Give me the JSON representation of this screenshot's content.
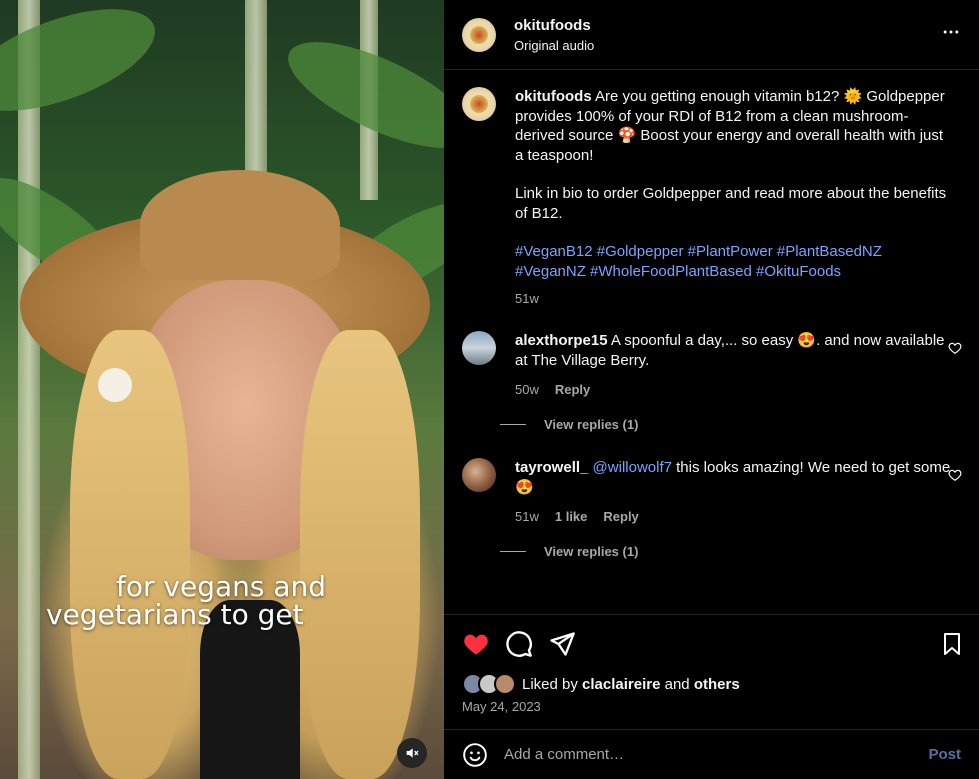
{
  "video": {
    "caption_line1": "for vegans and",
    "caption_line2": "vegetarians to get",
    "mute_icon": "speaker-muted-icon"
  },
  "header": {
    "username": "okitufoods",
    "audio": "Original audio",
    "more_icon": "more-horizontal-icon"
  },
  "post": {
    "username": "okitufoods",
    "text1": "Are you getting enough vitamin b12? 🌞 Goldpepper provides 100% of your RDI of B12 from a clean mushroom-derived source 🍄 Boost your energy and overall health with just a teaspoon!",
    "text2": "Link in bio to order Goldpepper and read more about the benefits of B12.",
    "hashtags": "#VeganB12 #Goldpepper #PlantPower #PlantBasedNZ #VeganNZ #WholeFoodPlantBased #OkituFoods",
    "time": "51w"
  },
  "comments": [
    {
      "username": "alexthorpe15",
      "text": "A spoonful a day,... so easy 😍. and now available at The Village Berry.",
      "time": "50w",
      "reply": "Reply",
      "view_replies": "View replies (1)"
    },
    {
      "username": "tayrowell_",
      "mention": "@willowolf7",
      "text": "this looks amazing! We need to get some 😍",
      "time": "51w",
      "likes": "1 like",
      "reply": "Reply",
      "view_replies": "View replies (1)"
    }
  ],
  "actions": {
    "liked_by_prefix": "Liked by",
    "liked_by_user": "claclaireire",
    "liked_by_and": "and",
    "liked_by_others": "others",
    "date": "May 24, 2023"
  },
  "add_comment": {
    "placeholder": "Add a comment…",
    "post": "Post"
  },
  "colors": {
    "like_red": "#ff3040",
    "hashtag_blue": "#7aa3ff",
    "post_button": "#5b6f9f"
  }
}
